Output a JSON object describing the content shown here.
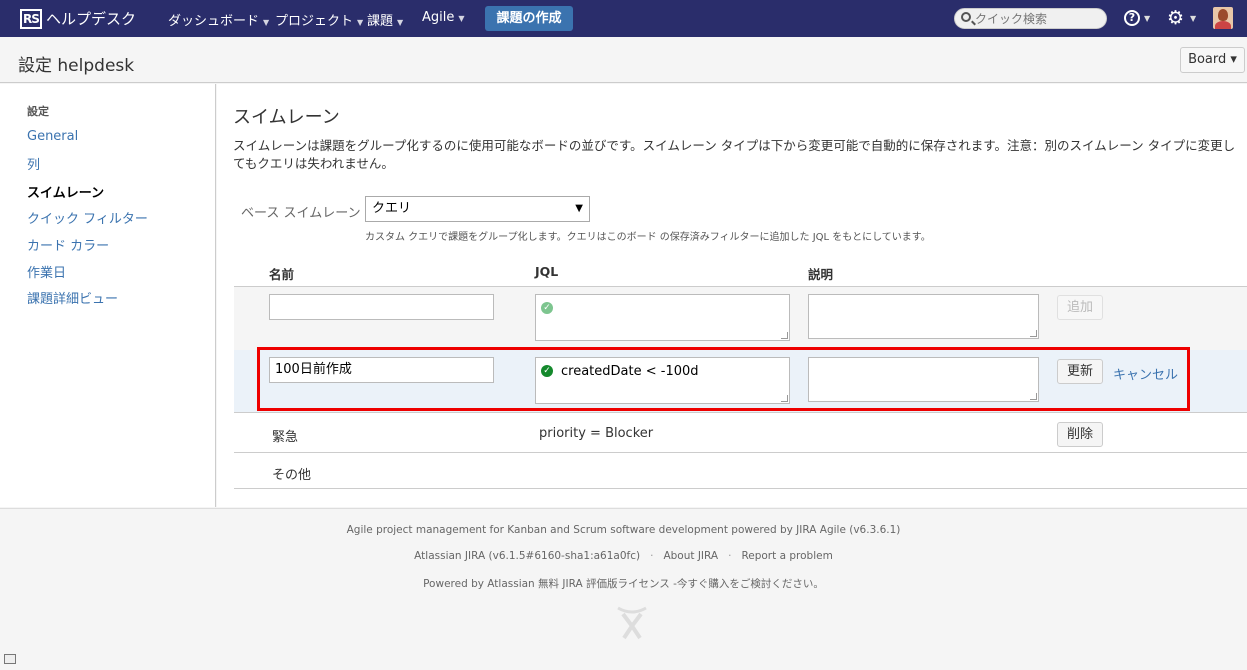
{
  "topnav": {
    "logo_mark": "RS",
    "logo_text": "ヘルプデスク",
    "items": [
      {
        "label": "ダッシュボード"
      },
      {
        "label": "プロジェクト"
      },
      {
        "label": "課題"
      },
      {
        "label": "Agile"
      }
    ],
    "create_button": "課題の作成",
    "search_placeholder": "クイック検索",
    "help_icon": "?"
  },
  "header": {
    "title": "設定  helpdesk",
    "board_button": "Board ▾"
  },
  "sidebar": {
    "heading": "設定",
    "items": [
      {
        "label": "General"
      },
      {
        "label": "列"
      },
      {
        "label": "スイムレーン"
      },
      {
        "label": "クイック フィルター"
      },
      {
        "label": "カード カラー"
      },
      {
        "label": "作業日"
      },
      {
        "label": "課題詳細ビュー"
      }
    ]
  },
  "main": {
    "title": "スイムレーン",
    "description": "スイムレーンは課題をグループ化するのに使用可能なボードの並びです。スイムレーン タイプは下から変更可能で自動的に保存されます。注意：別のスイムレーン タイプに変更してもクエリは失われません。",
    "base_label": "ベース スイムレーン",
    "base_value": "クエリ",
    "base_hint": "カスタム クエリで課題をグループ化します。クエリはこのボード の保存済みフィルターに追加した JQL をもとにしています。",
    "columns": {
      "name": "名前",
      "jql": "JQL",
      "description": "説明"
    },
    "add_row": {
      "add_button": "追加"
    },
    "edit_row": {
      "name": "100日前作成",
      "jql": "createdDate < -100d",
      "update_button": "更新",
      "cancel_link": "キャンセル"
    },
    "rows": [
      {
        "name": "緊急",
        "jql": "priority = Blocker",
        "delete_button": "削除"
      },
      {
        "name": "その他"
      }
    ]
  },
  "footer": {
    "line1": "Agile project management for Kanban and Scrum software development powered by JIRA Agile (v6.3.6.1)",
    "line2_a": "Atlassian JIRA (v6.1.5#6160-sha1:a61a0fc)",
    "line2_b": "About JIRA",
    "line2_c": "Report a problem",
    "line3": "Powered by Atlassian 無料 JIRA 評価版ライセンス -今すぐ購入をご検討ください。"
  }
}
